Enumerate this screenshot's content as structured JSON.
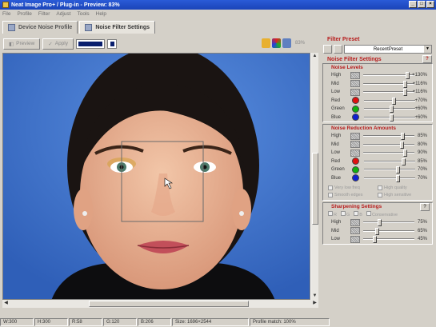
{
  "window": {
    "title": "Neat Image Pro+ / Plug-in - Preview: 83%"
  },
  "menu": [
    "File",
    "Profile",
    "Filter",
    "Adjust",
    "Tools",
    "Help"
  ],
  "tabs": [
    {
      "label": "Device Noise Profile",
      "active": false
    },
    {
      "label": "Noise Filter Settings",
      "active": true
    }
  ],
  "toolbar": {
    "preview_label": "Preview",
    "apply_label": "Apply",
    "zoom": "83%"
  },
  "filter_preset": {
    "title": "Filter Preset",
    "selected": "RecentPreset"
  },
  "noise_filter_settings": {
    "title": "Noise Filter Settings"
  },
  "noise_levels": {
    "title": "Noise Levels",
    "rows": [
      {
        "label": "High",
        "marker": "swatch",
        "value": "+130%",
        "level": 0.9
      },
      {
        "label": "Mid",
        "marker": "swatch",
        "value": "+116%",
        "level": 0.85
      },
      {
        "label": "Low",
        "marker": "swatch",
        "value": "+116%",
        "level": 0.85
      },
      {
        "label": "Red",
        "marker": "dot",
        "color": "#e01010",
        "value": "+70%",
        "level": 0.6
      },
      {
        "label": "Green",
        "marker": "dot",
        "color": "#10b010",
        "value": "+60%",
        "level": 0.55
      },
      {
        "label": "Blue",
        "marker": "dot",
        "color": "#1020d0",
        "value": "+60%",
        "level": 0.55
      }
    ]
  },
  "noise_reduction": {
    "title": "Noise Reduction Amounts",
    "rows": [
      {
        "label": "High",
        "marker": "swatch",
        "value": "85%",
        "level": 0.8
      },
      {
        "label": "Mid",
        "marker": "swatch",
        "value": "80%",
        "level": 0.78
      },
      {
        "label": "Low",
        "marker": "swatch",
        "value": "90%",
        "level": 0.85
      },
      {
        "label": "Red",
        "marker": "dot",
        "color": "#e01010",
        "value": "85%",
        "level": 0.8
      },
      {
        "label": "Green",
        "marker": "dot",
        "color": "#10b010",
        "value": "70%",
        "level": 0.68
      },
      {
        "label": "Blue",
        "marker": "dot",
        "color": "#1020d0",
        "value": "70%",
        "level": 0.68
      }
    ],
    "checks": [
      "Very low freq",
      "High quality",
      "Smooth edges",
      "High sensitive"
    ]
  },
  "sharpening": {
    "title": "Sharpening Settings",
    "checks": [
      "R",
      "G",
      "B",
      "Conservative"
    ],
    "rows": [
      {
        "label": "High",
        "marker": "swatch",
        "value": "75%",
        "level": 0.3
      },
      {
        "label": "Mid",
        "marker": "swatch",
        "value": "65%",
        "level": 0.25
      },
      {
        "label": "Low",
        "marker": "swatch",
        "value": "45%",
        "level": 0.2
      }
    ]
  },
  "status": {
    "w": "W:300",
    "h": "H:300",
    "r": "R:58",
    "g": "G:120",
    "b": "B:206",
    "size": "Size: 1696×2544",
    "profile": "Profile match: 100%"
  }
}
